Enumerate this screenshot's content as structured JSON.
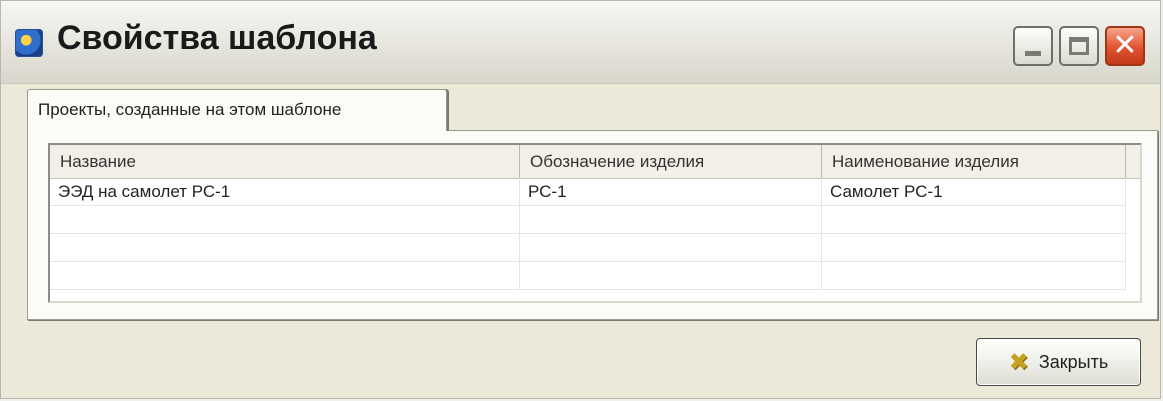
{
  "window": {
    "title": "Свойства шаблона",
    "app_icon": "app-globe-icon",
    "controls": {
      "minimize": "minimize-icon",
      "maximize": "maximize-icon",
      "close_glyph": "✕"
    }
  },
  "tabs": [
    {
      "label": "Проекты, созданные на этом шаблоне",
      "active": true
    }
  ],
  "table": {
    "columns": [
      "Название",
      "Обозначение изделия",
      "Наименование изделия"
    ],
    "rows": [
      [
        "ЭЭД на самолет РС-1",
        "РС-1",
        "Самолет РС-1"
      ],
      [
        "",
        "",
        ""
      ],
      [
        "",
        "",
        ""
      ],
      [
        "",
        "",
        ""
      ]
    ]
  },
  "footer": {
    "close_label": "Закрыть",
    "close_icon": "✖"
  }
}
